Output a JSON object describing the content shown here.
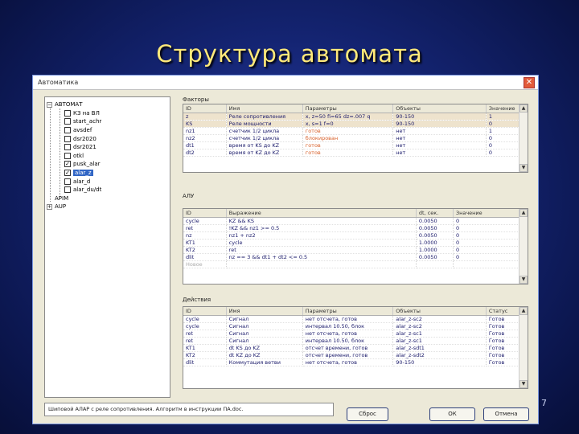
{
  "slide": {
    "title": "Структура автомата",
    "page_number": "7"
  },
  "window": {
    "title": "Автоматика",
    "close_symbol": "✕"
  },
  "tree": {
    "root_label": "АВТОМАТ",
    "items": [
      {
        "label": "КЗ на ВЛ",
        "checked": false
      },
      {
        "label": "start_achr",
        "checked": false
      },
      {
        "label": "avsdef",
        "checked": false
      },
      {
        "label": "dsr2020",
        "checked": false
      },
      {
        "label": "dsr2021",
        "checked": false
      },
      {
        "label": "otkl",
        "checked": false
      },
      {
        "label": "pusk_alar",
        "checked": true
      },
      {
        "label": "alar_z",
        "checked": true,
        "selected": true
      },
      {
        "label": "alar_d",
        "checked": false
      },
      {
        "label": "alar_du/dt",
        "checked": false
      }
    ],
    "other_roots": [
      "APIM",
      "AUP"
    ]
  },
  "factors": {
    "label": "Факторы",
    "columns": [
      "ID",
      "Имя",
      "Параметры",
      "Объекты",
      "Значение"
    ],
    "rows": [
      [
        "z",
        "Реле сопротивления",
        "x, z=50 fi=65 dz=.007 q",
        "90-150",
        "1"
      ],
      [
        "KS",
        "Реле мощности",
        "x, s=1 f=0",
        "90-150",
        "0"
      ],
      [
        "nz1",
        "счетчик 1/2 цикла",
        "готов",
        "нет",
        "1"
      ],
      [
        "nz2",
        "счетчик 1/2 цикла",
        "блокирован",
        "нет",
        "0"
      ],
      [
        "dt1",
        "время от KS до KZ",
        "готов",
        "нет",
        "0"
      ],
      [
        "dt2",
        "время от KZ до KZ",
        "готов",
        "нет",
        "0"
      ]
    ]
  },
  "logic": {
    "label": "АЛУ",
    "columns": [
      "ID",
      "Выражение",
      "dt, сек.",
      "Значение"
    ],
    "rows": [
      [
        "cycle",
        "KZ && KS",
        "0.0050",
        "0"
      ],
      [
        "ret",
        "!KZ && nz1 >= 0.5",
        "0.0050",
        "0"
      ],
      [
        "nz",
        "nz1 + nz2",
        "0.0050",
        "0"
      ],
      [
        "KT1",
        "cycle",
        "1.0000",
        "0"
      ],
      [
        "KT2",
        "ret",
        "1.0000",
        "0"
      ],
      [
        "dlit",
        "nz == 3 && dt1 + dt2 <= 0.5",
        "0.0050",
        "0"
      ]
    ],
    "new_row": "Новое"
  },
  "actions": {
    "label": "Действия",
    "columns": [
      "ID",
      "Имя",
      "Параметры",
      "Объекты",
      "Статус"
    ],
    "rows": [
      [
        "cycle",
        "Сигнал",
        "нет отсчета, готов",
        "alar_z-sc2",
        "Готов"
      ],
      [
        "cycle",
        "Сигнал",
        "интервал 10.50, блок",
        "alar_z-sc2",
        "Готов"
      ],
      [
        "ret",
        "Сигнал",
        "нет отсчета, готов",
        "alar_z-sc1",
        "Готов"
      ],
      [
        "ret",
        "Сигнал",
        "интервал 10.50, блок",
        "alar_z-sc1",
        "Готов"
      ],
      [
        "KT1",
        "dt KS до KZ",
        "отсчет времени, готов",
        "alar_z-sdt1",
        "Готов"
      ],
      [
        "KT2",
        "dt KZ до KZ",
        "отсчет времени, готов",
        "alar_z-sdt2",
        "Готов"
      ],
      [
        "dlit",
        "Коммутация ветви",
        "нет отсчета, готов",
        "90-150",
        "Готов"
      ]
    ]
  },
  "status_bar": "Шиповой АЛАР с реле сопротивления. Алгоритм в инструкции ПА.doc.",
  "buttons": {
    "reset": "Сброс",
    "ok": "ОК",
    "cancel": "Отмена"
  },
  "colors": {
    "slide_title": "#ffe97a",
    "selection": "#3166c5",
    "highlight_row": "#eee3cd",
    "orange_text": "#d8602a",
    "link_text": "#1a1a6a"
  }
}
